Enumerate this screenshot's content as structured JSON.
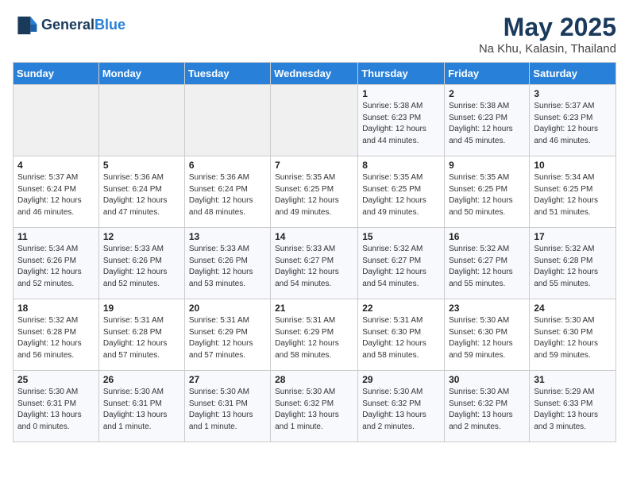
{
  "header": {
    "logo_line1": "General",
    "logo_line2": "Blue",
    "title": "May 2025",
    "subtitle": "Na Khu, Kalasin, Thailand"
  },
  "weekdays": [
    "Sunday",
    "Monday",
    "Tuesday",
    "Wednesday",
    "Thursday",
    "Friday",
    "Saturday"
  ],
  "weeks": [
    [
      {
        "num": "",
        "info": ""
      },
      {
        "num": "",
        "info": ""
      },
      {
        "num": "",
        "info": ""
      },
      {
        "num": "",
        "info": ""
      },
      {
        "num": "1",
        "info": "Sunrise: 5:38 AM\nSunset: 6:23 PM\nDaylight: 12 hours\nand 44 minutes."
      },
      {
        "num": "2",
        "info": "Sunrise: 5:38 AM\nSunset: 6:23 PM\nDaylight: 12 hours\nand 45 minutes."
      },
      {
        "num": "3",
        "info": "Sunrise: 5:37 AM\nSunset: 6:23 PM\nDaylight: 12 hours\nand 46 minutes."
      }
    ],
    [
      {
        "num": "4",
        "info": "Sunrise: 5:37 AM\nSunset: 6:24 PM\nDaylight: 12 hours\nand 46 minutes."
      },
      {
        "num": "5",
        "info": "Sunrise: 5:36 AM\nSunset: 6:24 PM\nDaylight: 12 hours\nand 47 minutes."
      },
      {
        "num": "6",
        "info": "Sunrise: 5:36 AM\nSunset: 6:24 PM\nDaylight: 12 hours\nand 48 minutes."
      },
      {
        "num": "7",
        "info": "Sunrise: 5:35 AM\nSunset: 6:25 PM\nDaylight: 12 hours\nand 49 minutes."
      },
      {
        "num": "8",
        "info": "Sunrise: 5:35 AM\nSunset: 6:25 PM\nDaylight: 12 hours\nand 49 minutes."
      },
      {
        "num": "9",
        "info": "Sunrise: 5:35 AM\nSunset: 6:25 PM\nDaylight: 12 hours\nand 50 minutes."
      },
      {
        "num": "10",
        "info": "Sunrise: 5:34 AM\nSunset: 6:25 PM\nDaylight: 12 hours\nand 51 minutes."
      }
    ],
    [
      {
        "num": "11",
        "info": "Sunrise: 5:34 AM\nSunset: 6:26 PM\nDaylight: 12 hours\nand 52 minutes."
      },
      {
        "num": "12",
        "info": "Sunrise: 5:33 AM\nSunset: 6:26 PM\nDaylight: 12 hours\nand 52 minutes."
      },
      {
        "num": "13",
        "info": "Sunrise: 5:33 AM\nSunset: 6:26 PM\nDaylight: 12 hours\nand 53 minutes."
      },
      {
        "num": "14",
        "info": "Sunrise: 5:33 AM\nSunset: 6:27 PM\nDaylight: 12 hours\nand 54 minutes."
      },
      {
        "num": "15",
        "info": "Sunrise: 5:32 AM\nSunset: 6:27 PM\nDaylight: 12 hours\nand 54 minutes."
      },
      {
        "num": "16",
        "info": "Sunrise: 5:32 AM\nSunset: 6:27 PM\nDaylight: 12 hours\nand 55 minutes."
      },
      {
        "num": "17",
        "info": "Sunrise: 5:32 AM\nSunset: 6:28 PM\nDaylight: 12 hours\nand 55 minutes."
      }
    ],
    [
      {
        "num": "18",
        "info": "Sunrise: 5:32 AM\nSunset: 6:28 PM\nDaylight: 12 hours\nand 56 minutes."
      },
      {
        "num": "19",
        "info": "Sunrise: 5:31 AM\nSunset: 6:28 PM\nDaylight: 12 hours\nand 57 minutes."
      },
      {
        "num": "20",
        "info": "Sunrise: 5:31 AM\nSunset: 6:29 PM\nDaylight: 12 hours\nand 57 minutes."
      },
      {
        "num": "21",
        "info": "Sunrise: 5:31 AM\nSunset: 6:29 PM\nDaylight: 12 hours\nand 58 minutes."
      },
      {
        "num": "22",
        "info": "Sunrise: 5:31 AM\nSunset: 6:30 PM\nDaylight: 12 hours\nand 58 minutes."
      },
      {
        "num": "23",
        "info": "Sunrise: 5:30 AM\nSunset: 6:30 PM\nDaylight: 12 hours\nand 59 minutes."
      },
      {
        "num": "24",
        "info": "Sunrise: 5:30 AM\nSunset: 6:30 PM\nDaylight: 12 hours\nand 59 minutes."
      }
    ],
    [
      {
        "num": "25",
        "info": "Sunrise: 5:30 AM\nSunset: 6:31 PM\nDaylight: 13 hours\nand 0 minutes."
      },
      {
        "num": "26",
        "info": "Sunrise: 5:30 AM\nSunset: 6:31 PM\nDaylight: 13 hours\nand 1 minute."
      },
      {
        "num": "27",
        "info": "Sunrise: 5:30 AM\nSunset: 6:31 PM\nDaylight: 13 hours\nand 1 minute."
      },
      {
        "num": "28",
        "info": "Sunrise: 5:30 AM\nSunset: 6:32 PM\nDaylight: 13 hours\nand 1 minute."
      },
      {
        "num": "29",
        "info": "Sunrise: 5:30 AM\nSunset: 6:32 PM\nDaylight: 13 hours\nand 2 minutes."
      },
      {
        "num": "30",
        "info": "Sunrise: 5:30 AM\nSunset: 6:32 PM\nDaylight: 13 hours\nand 2 minutes."
      },
      {
        "num": "31",
        "info": "Sunrise: 5:29 AM\nSunset: 6:33 PM\nDaylight: 13 hours\nand 3 minutes."
      }
    ]
  ]
}
